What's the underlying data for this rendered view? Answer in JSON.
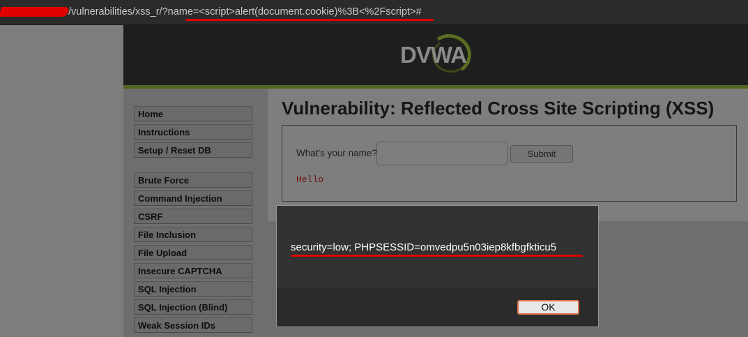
{
  "url_bar": {
    "url_visible": "/vulnerabilities/xss_r/?name=<script>alert(document.cookie)%3B<%2Fscript>#"
  },
  "header": {
    "logo_text": "DVWA"
  },
  "sidebar": {
    "items": [
      {
        "label": "Home"
      },
      {
        "label": "Instructions"
      },
      {
        "label": "Setup / Reset DB"
      },
      {
        "label": "Brute Force"
      },
      {
        "label": "Command Injection"
      },
      {
        "label": "CSRF"
      },
      {
        "label": "File Inclusion"
      },
      {
        "label": "File Upload"
      },
      {
        "label": "Insecure CAPTCHA"
      },
      {
        "label": "SQL Injection"
      },
      {
        "label": "SQL Injection (Blind)"
      },
      {
        "label": "Weak Session IDs"
      }
    ]
  },
  "main": {
    "title": "Vulnerability: Reflected Cross Site Scripting (XSS)",
    "form": {
      "label": "What's your name?",
      "input_value": "",
      "submit_label": "Submit"
    },
    "output": "Hello"
  },
  "alert_dialog": {
    "message": "security=low; PHPSESSID=omvedpu5n03iep8kfbgfkticu5",
    "ok_label": "OK"
  },
  "colors": {
    "highlight_red": "#e00000",
    "header_stripe": "#52641f"
  }
}
